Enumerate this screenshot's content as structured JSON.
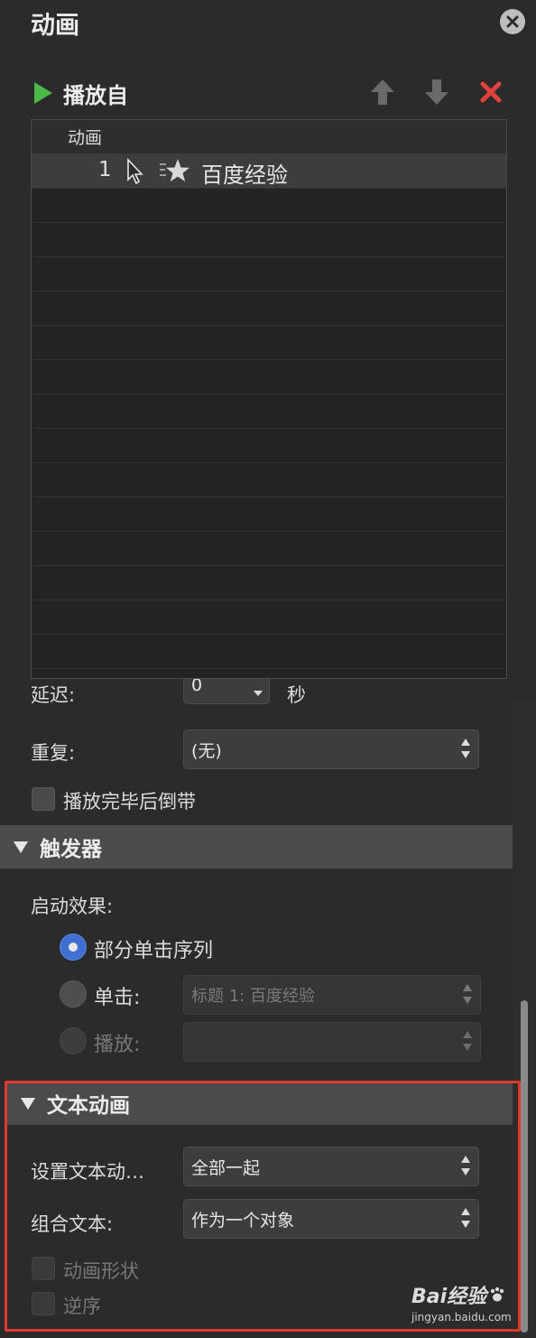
{
  "panel": {
    "title": "动画",
    "close_icon": "close-icon"
  },
  "toolbar": {
    "play_label": "播放自",
    "move_up_icon": "arrow-up-icon",
    "move_down_icon": "arrow-down-icon",
    "delete_icon": "delete-x-icon"
  },
  "animation_list": {
    "header": "动画",
    "rows": [
      {
        "number": "1",
        "trigger_icon": "mouse-cursor-icon",
        "effect_icon": "star-motion-icon",
        "name": "百度经验"
      }
    ]
  },
  "timing": {
    "delay_label": "延迟:",
    "delay_value": "0",
    "delay_unit": "秒",
    "repeat_label": "重复:",
    "repeat_value": "(无)",
    "rewind_label": "播放完毕后倒带"
  },
  "trigger_section": {
    "title": "触发器",
    "start_label": "启动效果:",
    "options": [
      {
        "label": "部分单击序列",
        "checked": true,
        "disabled": false
      },
      {
        "label": "单击:",
        "checked": false,
        "disabled": false,
        "select_value": "标题 1: 百度经验"
      },
      {
        "label": "播放:",
        "checked": false,
        "disabled": true,
        "select_value": ""
      }
    ]
  },
  "text_animation_section": {
    "title": "文本动画",
    "set_text_label": "设置文本动…",
    "set_text_value": "全部一起",
    "group_text_label": "组合文本:",
    "group_text_value": "作为一个对象",
    "animate_shape_label": "动画形状",
    "reverse_label": "逆序"
  },
  "watermark": {
    "brand": "Bai经验",
    "url": "jingyan.baidu.com"
  },
  "colors": {
    "panel_bg": "#2b2b2b",
    "section_bar": "#4b4b4b",
    "play_green": "#4cb848",
    "delete_red": "#e0413a",
    "radio_blue": "#3f6fd1",
    "highlight_red": "#e03a2e"
  }
}
